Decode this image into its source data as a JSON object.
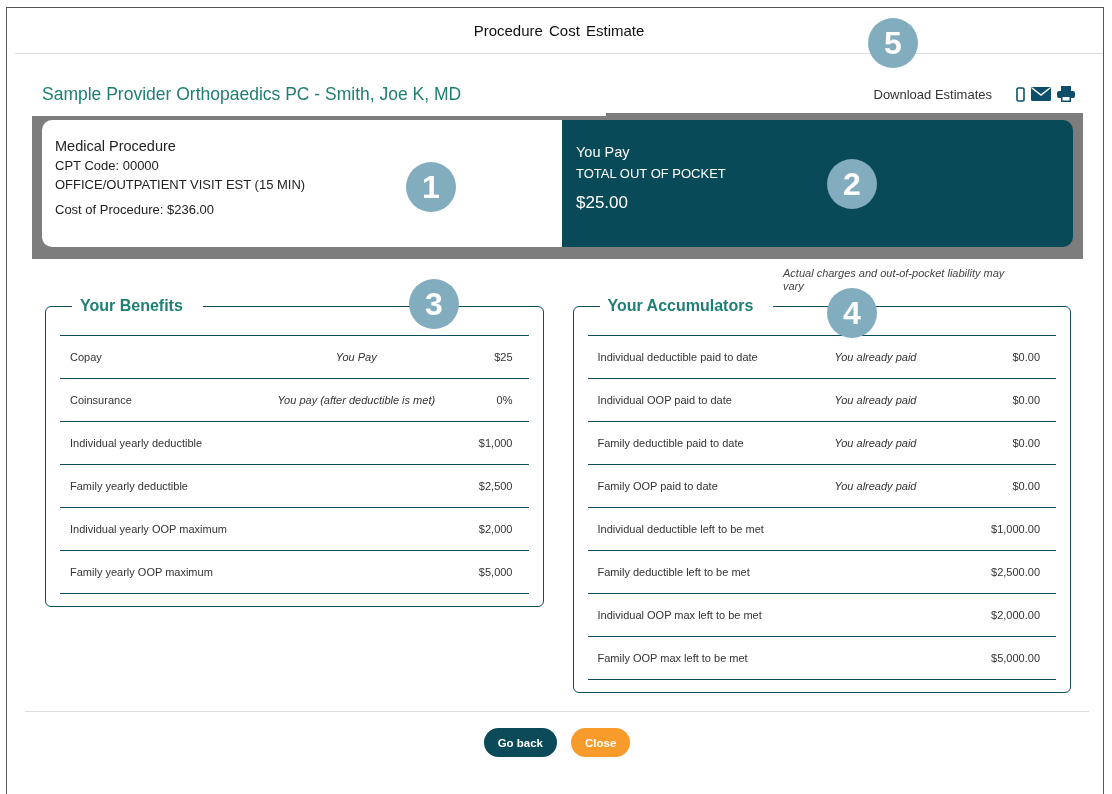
{
  "window": {
    "title": "Procedure Cost Estimate"
  },
  "provider": "Sample Provider Orthopaedics PC - Smith, Joe K, MD",
  "download": {
    "label": "Download Estimates"
  },
  "procedure": {
    "heading": "Medical Procedure",
    "cpt": "CPT Code: 00000",
    "description": "OFFICE/OUTPATIENT VISIT EST (15 MIN)",
    "cost": "Cost of Procedure: $236.00"
  },
  "you_pay": {
    "heading": "You Pay",
    "label": "TOTAL OUT OF POCKET",
    "amount": "$25.00"
  },
  "disclaimer": "Actual charges and out-of-pocket liability may vary",
  "benefits": {
    "title": "Your Benefits",
    "rows": [
      {
        "label": "Copay",
        "note": "You Pay",
        "value": "$25"
      },
      {
        "label": "Coinsurance",
        "note": "You pay (after deductible is met)",
        "value": "0%"
      },
      {
        "label": "Individual yearly deductible",
        "value": "$1,000"
      },
      {
        "label": "Family yearly deductible",
        "value": "$2,500"
      },
      {
        "label": "Individual yearly OOP maximum",
        "value": "$2,000"
      },
      {
        "label": "Family yearly OOP maximum",
        "value": "$5,000"
      }
    ]
  },
  "accumulators": {
    "title": "Your Accumulators",
    "rows": [
      {
        "label": "Individual deductible paid to date",
        "note": "You already paid",
        "value": "$0.00"
      },
      {
        "label": "Individual OOP paid to date",
        "note": "You already paid",
        "value": "$0.00"
      },
      {
        "label": "Family deductible paid to date",
        "note": "You already paid",
        "value": "$0.00"
      },
      {
        "label": "Family OOP paid to date",
        "note": "You already paid",
        "value": "$0.00"
      },
      {
        "label": "Individual deductible left to be met",
        "value": "$1,000.00"
      },
      {
        "label": "Family deductible left to be met",
        "value": "$2,500.00"
      },
      {
        "label": "Individual OOP max left to be met",
        "value": "$2,000.00"
      },
      {
        "label": "Family OOP max left to be met",
        "value": "$5,000.00"
      }
    ]
  },
  "buttons": [
    {
      "label": "Go back",
      "kind": "primary"
    },
    {
      "label": "Close",
      "kind": "secondary"
    }
  ],
  "callouts": [
    "1",
    "2",
    "3",
    "4",
    "5"
  ]
}
